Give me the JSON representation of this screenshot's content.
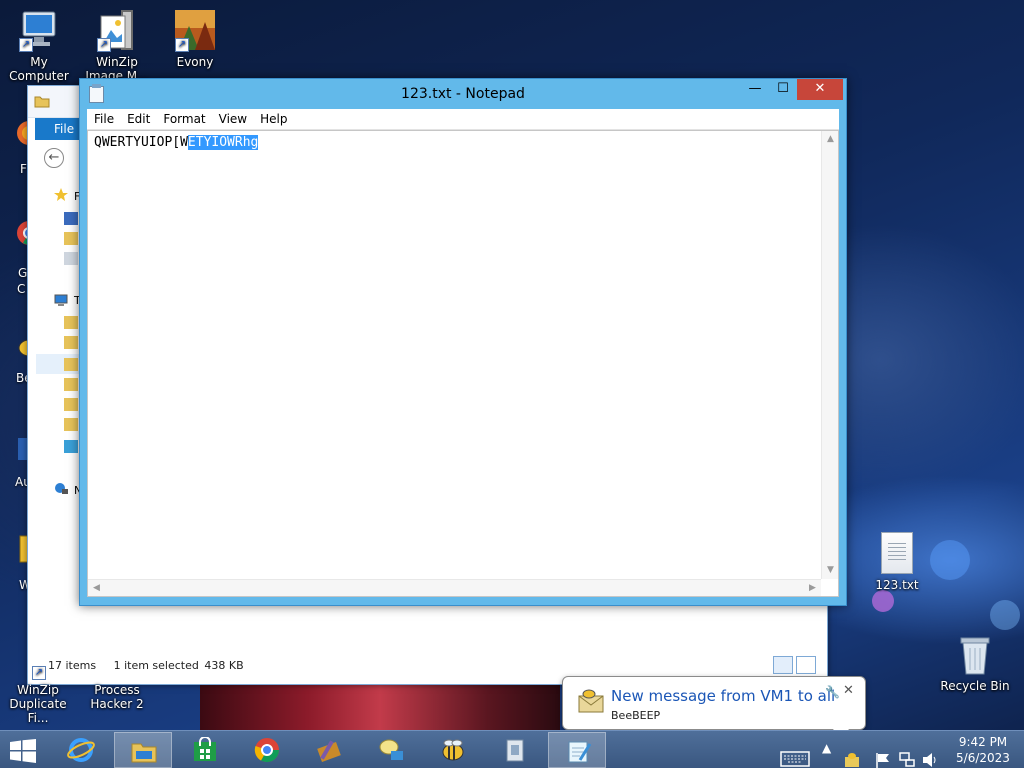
{
  "desktop": {
    "icons": [
      {
        "label": "My Computer",
        "icon": "computer-icon"
      },
      {
        "label": "WinZip Image M...",
        "icon": "winzip-image-icon"
      },
      {
        "label": "Evony",
        "icon": "evony-icon"
      },
      {
        "label": "123.txt",
        "icon": "text-file-icon"
      },
      {
        "label": "Recycle Bin",
        "icon": "recycle-bin-icon"
      },
      {
        "label": "WinZip Duplicate Fi...",
        "icon": "winzip-duplicate-icon"
      },
      {
        "label": "Process Hacker 2",
        "icon": "process-hacker-icon"
      }
    ],
    "edge_labels": [
      "F",
      "G",
      "C",
      "Be",
      "Au",
      "W"
    ]
  },
  "explorer": {
    "ribbon_tab": "File",
    "nav_letters": [
      "F",
      "T",
      "N"
    ],
    "status_items": "17 items",
    "status_selected": "1 item selected",
    "status_size": "438 KB"
  },
  "notepad": {
    "title": "123.txt - Notepad",
    "menu": [
      "File",
      "Edit",
      "Format",
      "View",
      "Help"
    ],
    "text_before_selection": "QWERTYUIOP[W",
    "text_selected": "ETYIOWRhg",
    "buttons": {
      "minimize": "—",
      "maximize": "☐",
      "close": "✕"
    }
  },
  "notification": {
    "title": "New message from VM1 to all",
    "app": "BeeBEEP",
    "pin": "🔧",
    "close": "✕"
  },
  "taskbar": {
    "apps": [
      "start",
      "internet-explorer",
      "file-explorer",
      "store",
      "chrome",
      "winzip-tools",
      "messenger",
      "beebeep",
      "archive",
      "notepad"
    ],
    "clock_time": "9:42 PM",
    "clock_date": "5/6/2023"
  },
  "colors": {
    "notepad_frame": "#62b9ea",
    "selection": "#3399ff",
    "close_button": "#c7463a",
    "taskbar": "#3a5780",
    "explorer_ribbon": "#1979ca",
    "notification_title": "#1b56b6"
  }
}
